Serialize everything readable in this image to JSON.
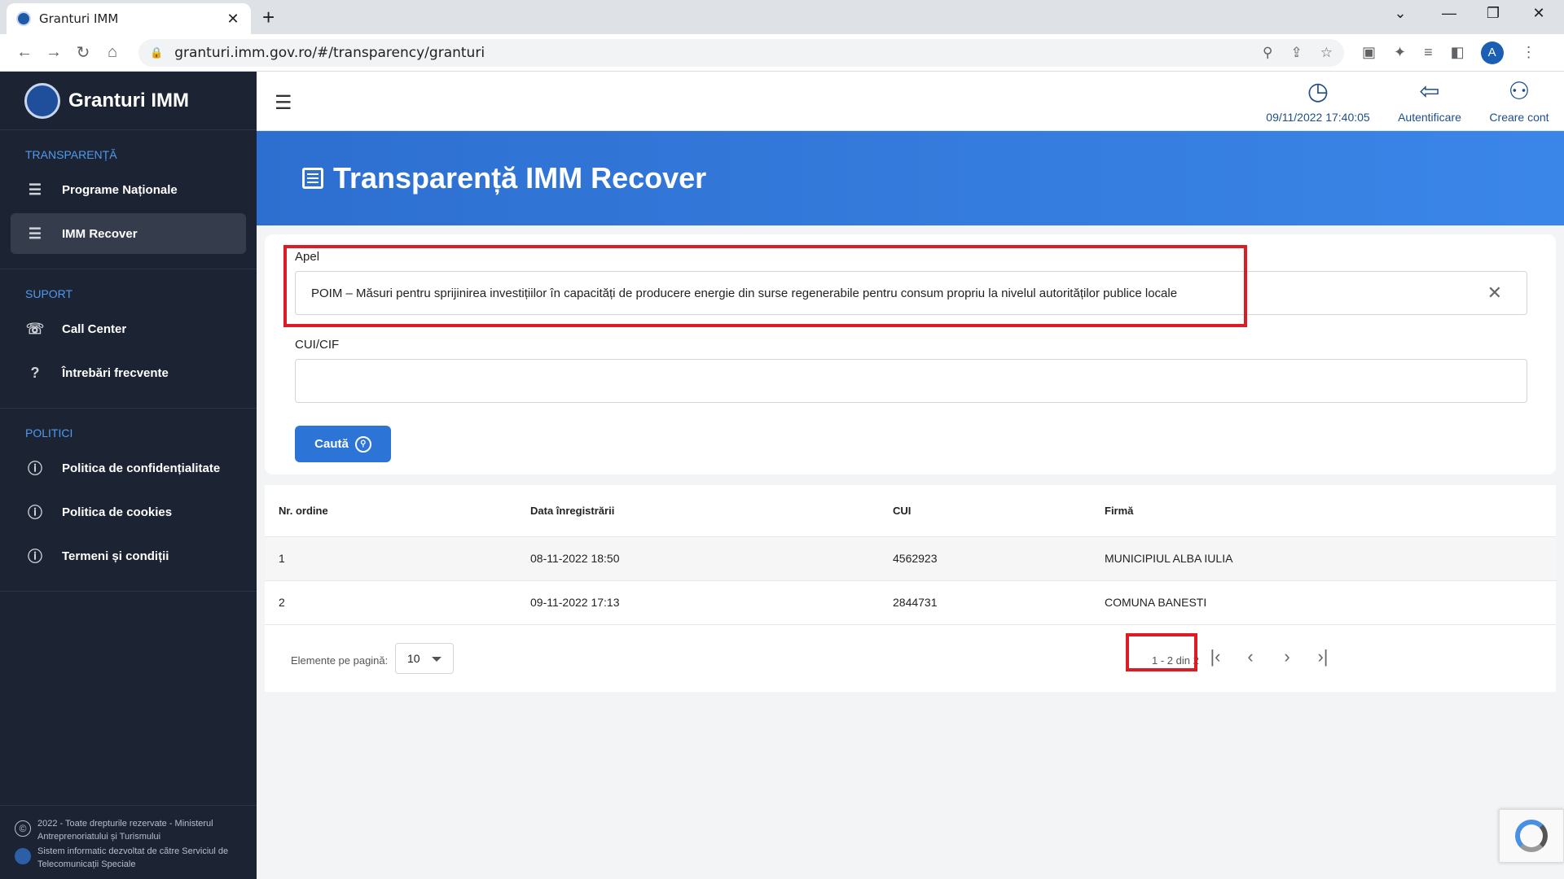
{
  "browser": {
    "tab_title": "Granturi IMM",
    "tab_close": "✕",
    "new_tab": "+",
    "url": "granturi.imm.gov.ro/#/transparency/granturi",
    "profile_initial": "A"
  },
  "sidebar": {
    "brand": "Granturi IMM",
    "sections": [
      {
        "title": "TRANSPARENȚĂ",
        "items": [
          {
            "label": "Programe Naționale",
            "icon": "list-icon"
          },
          {
            "label": "IMM Recover",
            "icon": "list-icon",
            "active": true
          }
        ]
      },
      {
        "title": "SUPORT",
        "items": [
          {
            "label": "Call Center",
            "icon": "contact-card-icon"
          },
          {
            "label": "Întrebări frecvente",
            "icon": "question-icon"
          }
        ]
      },
      {
        "title": "POLITICI",
        "items": [
          {
            "label": "Politica de confidențialitate",
            "icon": "info-icon"
          },
          {
            "label": "Politica de cookies",
            "icon": "info-icon"
          },
          {
            "label": "Termeni și condiții",
            "icon": "info-icon"
          }
        ]
      }
    ],
    "footer": {
      "copyright": "2022 - Toate drepturile rezervate - Ministerul Antreprenoriatului și Turismului",
      "developer": "Sistem informatic dezvoltat de către Serviciul de Telecomunicații Speciale"
    }
  },
  "topbar": {
    "datetime": "09/11/2022 17:40:05",
    "login_label": "Autentificare",
    "signup_label": "Creare cont"
  },
  "page": {
    "title": "Transparență IMM Recover"
  },
  "filters": {
    "apel_label": "Apel",
    "apel_value": "POIM – Măsuri pentru sprijinirea investițiilor în capacități de producere energie din surse regenerabile pentru consum propriu la nivelul autorităților publice locale",
    "cui_label": "CUI/CIF",
    "cui_value": "",
    "search_label": "Caută"
  },
  "table": {
    "headers": [
      "Nr. ordine",
      "Data înregistrării",
      "CUI",
      "Firmă"
    ],
    "rows": [
      [
        "1",
        "08-11-2022 18:50",
        "4562923",
        "MUNICIPIUL ALBA IULIA"
      ],
      [
        "2",
        "09-11-2022 17:13",
        "2844731",
        "COMUNA BANESTI"
      ]
    ]
  },
  "pagination": {
    "per_page_label": "Elemente pe pagină:",
    "per_page_value": "10",
    "range": "1 - 2 din 2"
  },
  "colors": {
    "accent": "#2d74d7",
    "sidebar_bg": "#1c2333",
    "highlight": "#dc1c24"
  }
}
